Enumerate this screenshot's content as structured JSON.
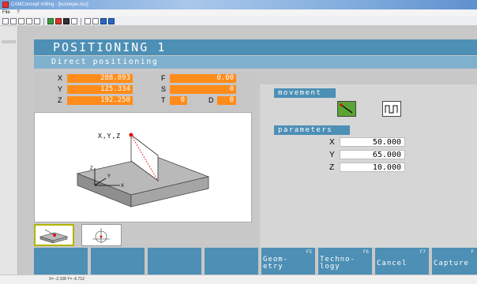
{
  "window": {
    "title": "CAMConcept milling - [kuzenjas.ncc]",
    "menu": [
      "File",
      "?"
    ]
  },
  "app": {
    "title": "POSITIONING 1",
    "subtitle": "Direct positioning",
    "coords": {
      "x_label": "X",
      "x_value": "288.093",
      "y_label": "Y",
      "y_value": "125.334",
      "z_label": "Z",
      "z_value": "192.250",
      "f_label": "F",
      "f_value": "0.00",
      "s_label": "S",
      "s_value": "0",
      "t_label": "T",
      "t_value": "0",
      "d_label": "D",
      "d_value": "0"
    },
    "view_label": "X,Y,Z",
    "movement": {
      "label": "movement"
    },
    "parameters": {
      "label": "parameters",
      "x_label": "X",
      "x_value": "50.000",
      "y_label": "Y",
      "y_value": "65.000",
      "z_label": "Z",
      "z_value": "10.000"
    },
    "softkeys": [
      {
        "fkey": "",
        "label": ""
      },
      {
        "fkey": "",
        "label": ""
      },
      {
        "fkey": "",
        "label": ""
      },
      {
        "fkey": "",
        "label": ""
      },
      {
        "fkey": "F5",
        "label": "Geom-\netry"
      },
      {
        "fkey": "F6",
        "label": "Techno-\nlogy"
      },
      {
        "fkey": "F7",
        "label": "Cancel"
      },
      {
        "fkey": "F",
        "label": "Capture"
      }
    ]
  },
  "statusbar": {
    "text": "X= -2.108 Y= -6.712"
  },
  "colors": {
    "accent": "#4d8fb5",
    "value_field": "#ff8c1a",
    "active_green": "#5ba433"
  },
  "icons": [
    "new-file-icon",
    "open-icon",
    "save-icon",
    "undo-icon",
    "redo-icon",
    "line-move-icon",
    "step-move-icon"
  ]
}
